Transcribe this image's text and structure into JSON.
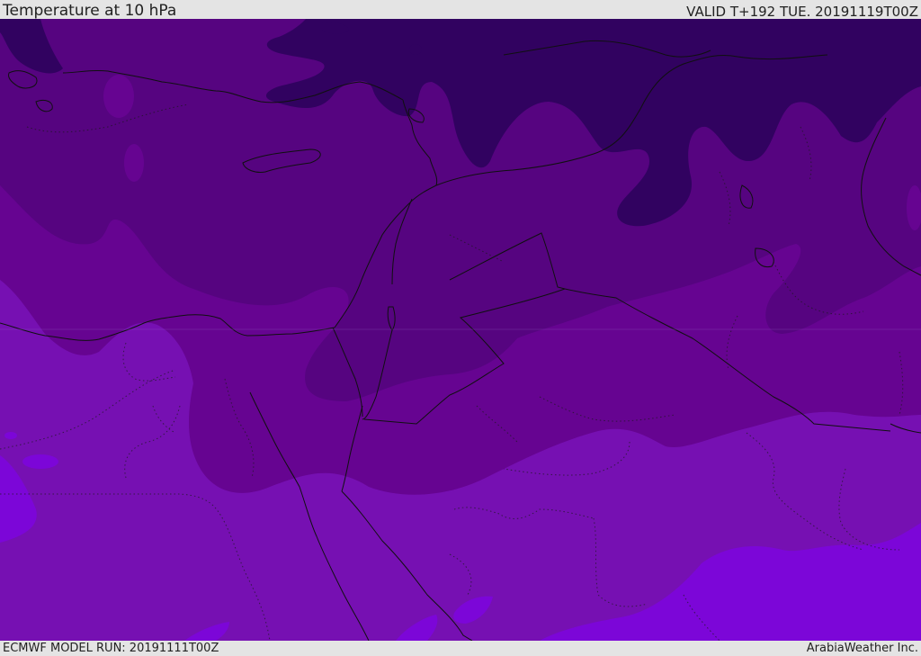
{
  "header": {
    "title": "Temperature at 10 hPa",
    "valid": "VALID T+192 TUE. 20191119T00Z"
  },
  "footer": {
    "model_run": "ECMWF MODEL RUN: 20191111T00Z",
    "credit": "ArabiaWeather Inc."
  },
  "map": {
    "variable": "Temperature",
    "level": "10 hPa",
    "colors": {
      "band_darkest": "#310260",
      "band_dark": "#560480",
      "band_mid": "#660491",
      "band_light": "#7610b2",
      "band_bright": "#7c06d8",
      "coastline": "#101010",
      "border": "#101010"
    }
  }
}
